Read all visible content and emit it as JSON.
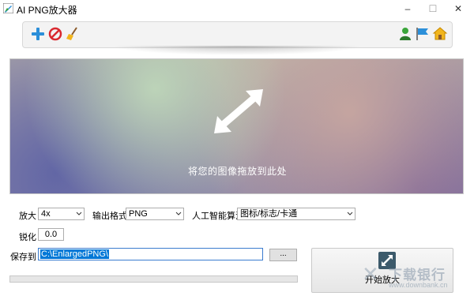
{
  "window": {
    "title": "AI PNG放大器",
    "controls": {
      "minimize": "–",
      "maximize": "☐",
      "close": "✕"
    }
  },
  "toolbar": {
    "left_icons": [
      "add-icon",
      "remove-icon",
      "clear-broom-icon"
    ],
    "right_icons": [
      "user-icon",
      "flag-icon",
      "home-icon"
    ]
  },
  "dropzone": {
    "hint": "将您的图像拖放到此处",
    "icon": "resize-arrow-icon"
  },
  "options": {
    "scale_label": "放大",
    "scale_value": "4x",
    "format_label": "输出格式",
    "format_value": "PNG",
    "algorithm_label": "人工智能算法",
    "algorithm_value": "图标/标志/卡通",
    "sharpen_label": "锐化",
    "sharpen_value": "0.0",
    "save_label": "保存到",
    "save_path": "C:\\EnlargedPNG\\",
    "browse_label": "..."
  },
  "start": {
    "label": "开始放大",
    "icon": "enlarge-icon"
  },
  "progress": {
    "percent": 0
  },
  "watermark": {
    "text": "下载银行",
    "url": "www.downbank.cn"
  },
  "colors": {
    "accent": "#0078d7",
    "icon_blue": "#2b8fd9",
    "icon_red": "#d9282f",
    "icon_green": "#3aa53a",
    "home_yellow": "#f2b51c"
  }
}
